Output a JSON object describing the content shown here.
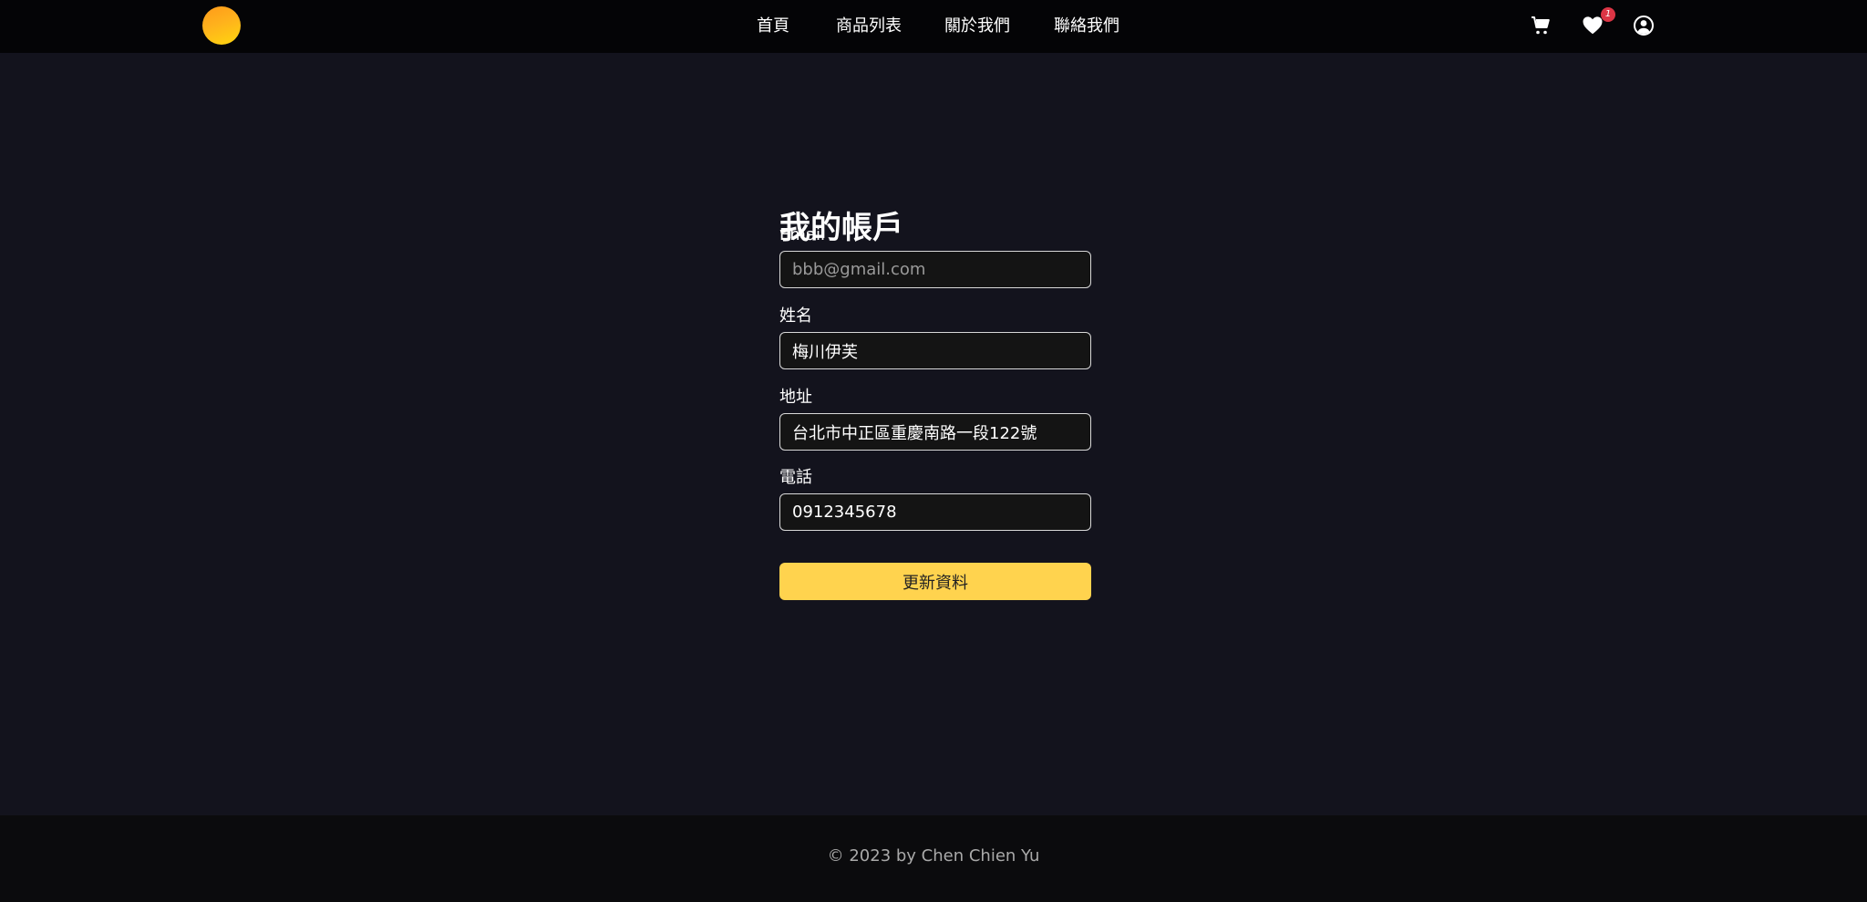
{
  "header": {
    "nav": [
      {
        "label": "首頁"
      },
      {
        "label": "商品列表"
      },
      {
        "label": "關於我們"
      },
      {
        "label": "聯絡我們"
      }
    ],
    "icons": {
      "cart": "cart-icon",
      "favorites": "heart-icon",
      "account": "user-circle-icon"
    },
    "favorites_count": "1"
  },
  "main": {
    "title": "我的帳戶",
    "fields": {
      "email": {
        "label": "Email",
        "value": "",
        "placeholder": "bbb@gmail.com"
      },
      "name": {
        "label": "姓名",
        "value": "梅川伊芙"
      },
      "address": {
        "label": "地址",
        "value": "台北市中正區重慶南路一段122號"
      },
      "phone": {
        "label": "電話",
        "value": "0912345678"
      }
    },
    "submit_label": "更新資料"
  },
  "footer": {
    "text": "© 2023 by Chen Chien Yu"
  },
  "colors": {
    "background": "#13131d",
    "navbar": "#040406",
    "footer": "#0b0b0d",
    "accent": "#ffd34e",
    "badge": "#dc3545"
  }
}
